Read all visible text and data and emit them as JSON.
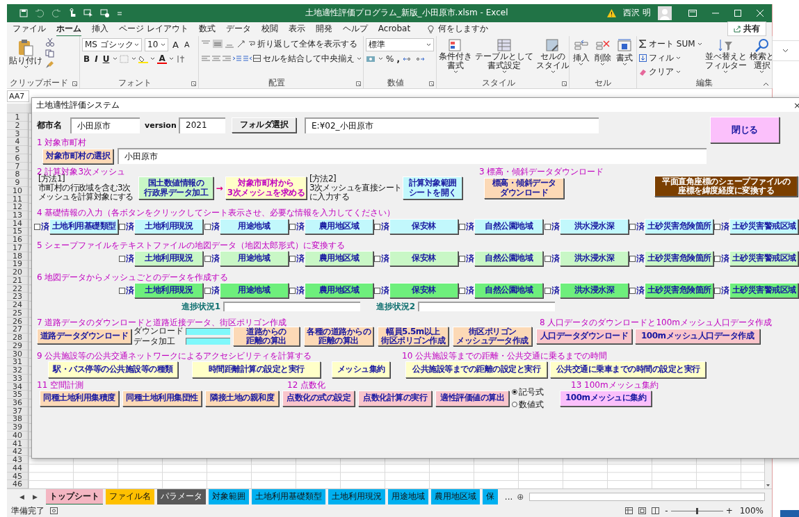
{
  "title_bar": {
    "title": "土地適性評価プログラム_新版_小田原市.xlsm  -  Excel",
    "user": "西沢 明"
  },
  "ribbon_tabs": [
    {
      "label": "ファイル",
      "selected": false
    },
    {
      "label": "ホーム",
      "selected": true
    },
    {
      "label": "挿入",
      "selected": false
    },
    {
      "label": "ページ レイアウト",
      "selected": false
    },
    {
      "label": "数式",
      "selected": false
    },
    {
      "label": "データ",
      "selected": false
    },
    {
      "label": "校閲",
      "selected": false
    },
    {
      "label": "表示",
      "selected": false
    },
    {
      "label": "開発",
      "selected": false
    },
    {
      "label": "ヘルプ",
      "selected": false
    },
    {
      "label": "Acrobat",
      "selected": false
    }
  ],
  "tell_me": "何をしますか",
  "share": "共有",
  "ribbon": {
    "clipboard": {
      "paste": "貼り付け",
      "label": "クリップボード"
    },
    "font": {
      "name": "MS ゴシック",
      "size": "10",
      "grow": "A",
      "shrink": "A",
      "bold": "B",
      "italic": "I",
      "underline": "U",
      "font_color": "A",
      "label": "フォント"
    },
    "alignment": {
      "wrap": "折り返して全体を表示する",
      "merge": "セルを結合して中央揃え",
      "label": "配置"
    },
    "number": {
      "format": "標準",
      "percent": "%",
      "comma": ",",
      "label": "数値"
    },
    "styles": {
      "buttons": [
        [
          "条件付き",
          "書式"
        ],
        [
          "テーブルとして",
          "書式設定"
        ],
        [
          "セルの",
          "スタイル"
        ]
      ],
      "label": "スタイル"
    },
    "cells": {
      "buttons": [
        "挿入",
        "削除",
        "書式"
      ],
      "label": "セル"
    },
    "editing": {
      "autosum": "オート SUM",
      "fill": "フィル",
      "clear": "クリア",
      "buttons": [
        [
          "並べ替えと",
          "フィルター"
        ],
        [
          "検索と",
          "選択"
        ]
      ],
      "label": "編集"
    }
  },
  "name_box": "AA7",
  "row_numbers": [
    "1",
    "2",
    "3",
    "4",
    "5",
    "6",
    "7",
    "8",
    "9",
    "10",
    "11",
    "12",
    "13",
    "14",
    "15",
    "16",
    "17",
    "18",
    "19",
    "20",
    "21",
    "22",
    "23",
    "24",
    "25",
    "26",
    "27",
    "28",
    "29",
    "30",
    "31",
    "32",
    "33",
    "34",
    "35",
    "36",
    "37",
    "38",
    "39",
    "40",
    "41",
    "42",
    "43",
    "44",
    "45",
    "46"
  ],
  "form": {
    "title": "土地適性評価システム",
    "close": "×",
    "city_label": "都市名",
    "city": "小田原市",
    "version_label": "version",
    "version": "2021",
    "folder_button": "フォルダ選択",
    "folder_path": "E:¥02_小田原市",
    "close_button": "閉じる",
    "s1": {
      "heading": "1 対象市町村",
      "button": "対象市町村の選択",
      "value": "小田原市"
    },
    "s2": {
      "heading": "2 計算対象3次メッシュ",
      "method1": [
        "[方法1]",
        "市町村の行政域を含む3次",
        "メッシュを計算対象にする"
      ],
      "button1": [
        "国土数値情報の",
        "行政界データ加工"
      ],
      "arrow": "→",
      "button2": [
        "対象市町村から",
        "3次メッシュを求める"
      ],
      "method2": [
        "[方法2]",
        "3次メッシュを直接シート",
        "に入力する"
      ],
      "button3": [
        "計算対象範囲",
        "シートを開く"
      ]
    },
    "s3": {
      "heading": "3  標高・傾斜データダウンロード",
      "button": [
        "標高・傾斜データ",
        "ダウンロード"
      ]
    },
    "convert_button": [
      "平面直角座標のシェープファイルの",
      "座標を緯度経度に変換する"
    ],
    "s4": {
      "heading": "4 基礎情報の入力（各ボタンをクリックしてシート表示させ、必要な情報を入力してください）",
      "items": [
        {
          "check_label": "済",
          "checked": false,
          "button": "土地利用基礎類型"
        },
        {
          "check_label": "済",
          "checked": false,
          "button": "土地利用現況"
        },
        {
          "check_label": "済",
          "checked": false,
          "button": "用途地域"
        },
        {
          "check_label": "済",
          "checked": false,
          "button": "農用地区域"
        },
        {
          "check_label": "済",
          "checked": false,
          "button": "保安林"
        },
        {
          "check_label": "済",
          "checked": false,
          "button": "自然公園地域"
        },
        {
          "check_label": "済",
          "checked": false,
          "button": "洪水浸水深"
        },
        {
          "check_label": "済",
          "checked": false,
          "button": "土砂災害危険箇所"
        },
        {
          "check_label": "済",
          "checked": false,
          "button": "土砂災害警戒区域"
        }
      ]
    },
    "s5": {
      "heading": "5 シェープファイルをテキストファイルの地図データ（地図太郎形式）に変換する",
      "items": [
        {
          "check_label": "済",
          "checked": false,
          "button": "土地利用現況"
        },
        {
          "check_label": "済",
          "checked": false,
          "button": "用途地域"
        },
        {
          "check_label": "済",
          "checked": false,
          "button": "農用地区域"
        },
        {
          "check_label": "済",
          "checked": false,
          "button": "保安林"
        },
        {
          "check_label": "済",
          "checked": false,
          "button": "自然公園地域"
        },
        {
          "check_label": "済",
          "checked": false,
          "button": "洪水浸水深"
        },
        {
          "check_label": "済",
          "checked": false,
          "button": "土砂災害危険箇所"
        },
        {
          "check_label": "済",
          "checked": false,
          "button": "土砂災害警戒区域"
        }
      ]
    },
    "s6": {
      "heading": "6 地図データからメッシュごとのデータを作成する",
      "items": [
        {
          "check_label": "済",
          "checked": false,
          "button": "土地利用現況"
        },
        {
          "check_label": "済",
          "checked": false,
          "button": "用途地域"
        },
        {
          "check_label": "済",
          "checked": false,
          "button": "農用地区域"
        },
        {
          "check_label": "済",
          "checked": false,
          "button": "保安林"
        },
        {
          "check_label": "済",
          "checked": false,
          "button": "自然公園地域"
        },
        {
          "check_label": "済",
          "checked": false,
          "button": "洪水浸水深"
        },
        {
          "check_label": "済",
          "checked": false,
          "button": "土砂災害危険箇所"
        },
        {
          "check_label": "済",
          "checked": false,
          "button": "土砂災害警戒区域"
        }
      ]
    },
    "progress": [
      {
        "label": "進捗状況1"
      },
      {
        "label": "進捗状況2"
      }
    ],
    "s7": {
      "heading": "7 道路データのダウンロードと道路近接データ、街区ポリゴン作成",
      "download_button": "道路データダウンロード",
      "bars": [
        {
          "label": "ダウンロード",
          "level": 1
        },
        {
          "label": "データ加工",
          "level": 1
        }
      ],
      "buttons": [
        [
          "道路からの",
          "距離の算出"
        ],
        [
          "各種の道路からの",
          "距離の算出"
        ],
        [
          "幅員5.5m以上",
          "街区ポリゴン作成"
        ],
        [
          "街区ポリゴン",
          "メッシュデータ作成"
        ]
      ]
    },
    "s8": {
      "heading": "8 人口データのダウンロードと100mメッシュ人口データ作成",
      "buttons": [
        "人口データダウンロード",
        "100mメッシュ人口データ作成"
      ]
    },
    "s9": {
      "heading": "9 公共施設等の公共交通ネットワークによるアクセシビリティを計算する",
      "buttons": [
        "駅・バス停等の公共施設等の種類",
        "時間距離計算の設定と実行",
        "メッシュ集約"
      ]
    },
    "s10": {
      "heading": "10 公共施設等までの距離・公共交通に乗るまでの時間",
      "buttons": [
        "公共施設等までの距離の設定と実行",
        "公共交通に乗車までの時間の設定と実行"
      ]
    },
    "s11": {
      "heading": "11 空間計測",
      "buttons": [
        "同種土地利用集積度",
        "同種土地利用集団性",
        "隣接土地の親和度"
      ]
    },
    "s12": {
      "heading": "12 点数化",
      "buttons": [
        "点数化の式の設定",
        "点数化計算の実行",
        "適性評価値の算出"
      ],
      "options": [
        {
          "label": "記号式",
          "selected": true
        },
        {
          "label": "数値式",
          "selected": false
        }
      ]
    },
    "s13": {
      "heading": "13 100mメッシュ集約",
      "button": "100mメッシュに集約"
    }
  },
  "sheet_nav": [
    "◀",
    "▶"
  ],
  "sheet_tabs": [
    {
      "label": "トップシート",
      "selected": true,
      "color": "#f4b6c2"
    },
    {
      "label": "ファイル名",
      "selected": false,
      "color": "#ffc000"
    },
    {
      "label": "パラメータ",
      "selected": false,
      "color": "#595959"
    },
    {
      "label": "対象範囲",
      "selected": false,
      "color": "#00b0f0"
    },
    {
      "label": "土地利用基礎類型",
      "selected": false,
      "color": "#00b0f0"
    },
    {
      "label": "土地利用現況",
      "selected": false,
      "color": "#00b0f0"
    },
    {
      "label": "用途地域",
      "selected": false,
      "color": "#00b0f0"
    },
    {
      "label": "農用地区域",
      "selected": false,
      "color": "#00b0f0"
    },
    {
      "label": "保",
      "selected": false,
      "color": "#00b0f0"
    }
  ],
  "more_tabs": "...",
  "add_sheet": "⊕",
  "status": {
    "text": "準備完了",
    "zoom": "100%",
    "zoom_minus": "-",
    "zoom_plus": "+",
    "zoom_slider": {
      "level": 0.5
    }
  }
}
